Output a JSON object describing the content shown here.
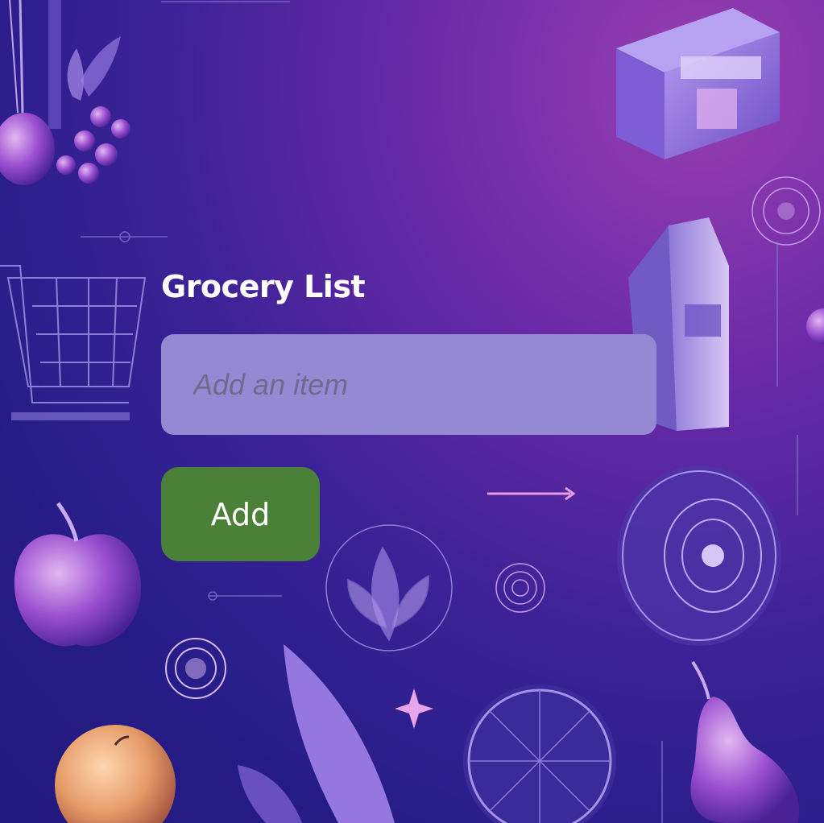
{
  "app": {
    "title": "Grocery List"
  },
  "form": {
    "item_input_value": "",
    "item_input_placeholder": "Add an item",
    "add_button_label": "Add"
  },
  "colors": {
    "input_background": "#9689d4",
    "button_background": "#4b8038",
    "title_text": "#ffffff"
  }
}
